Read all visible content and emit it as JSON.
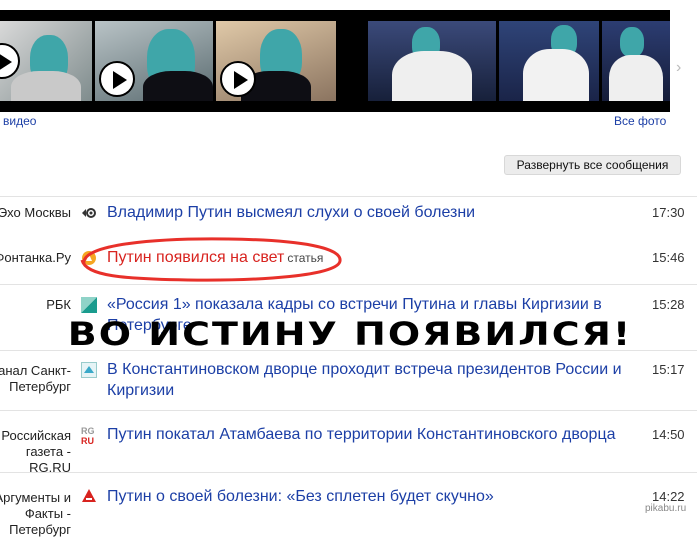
{
  "gallery": {
    "video_link": "видео",
    "photo_link": "Все фото"
  },
  "expand_button": "Развернуть все сообщения",
  "news": [
    {
      "source": "Эхо Москвы",
      "headline": "Владимир Путин высмеял слухи о своей болезни",
      "tag": "",
      "time": "17:30",
      "icon": "echo-icon",
      "highlight": false
    },
    {
      "source": "Фонтанка.Ру",
      "headline": "Путин появился на свет",
      "tag": "статья",
      "time": "15:46",
      "icon": "fontanka-icon",
      "highlight": true
    },
    {
      "source": "РБК",
      "headline": "«Россия 1» показала кадры со встречи Путина и главы Киргизии в Петербурге",
      "tag": "",
      "time": "15:28",
      "icon": "rbc-icon",
      "highlight": false
    },
    {
      "source": "Канал Санкт-Петербург",
      "headline": "В Константиновском дворце проходит встреча президентов России и Киргизии",
      "tag": "",
      "time": "15:17",
      "icon": "spb-channel-icon",
      "highlight": false
    },
    {
      "source": "Российская газета - RG.RU",
      "headline": "Путин покатал Атамбаева по территории Константиновского дворца",
      "tag": "",
      "time": "14:50",
      "icon": "rg-icon",
      "highlight": false
    },
    {
      "source": "Аргументы и Факты - Петербург",
      "headline": "Путин о своей болезни: «Без сплетен будет скучно»",
      "tag": "",
      "time": "14:22",
      "icon": "aif-icon",
      "highlight": false
    }
  ],
  "overlay_caption": "ВО ИСТИНУ ПОЯВИЛСЯ!",
  "watermark": "pikabu.ru",
  "colors": {
    "link": "#1c3fa6",
    "highlight": "#d8231f",
    "oval": "#e8302a"
  }
}
